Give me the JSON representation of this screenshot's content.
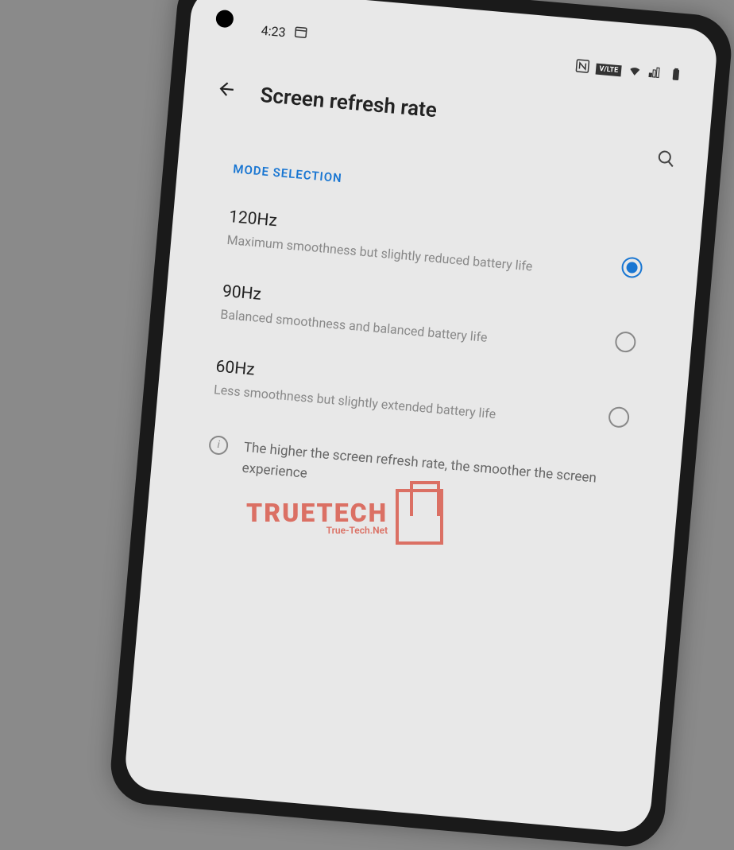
{
  "status_bar": {
    "time": "4:23",
    "volte_label": "V/LTE"
  },
  "header": {
    "title": "Screen refresh rate"
  },
  "section_label": "MODE SELECTION",
  "options": [
    {
      "title": "120Hz",
      "description": "Maximum smoothness but slightly reduced battery life",
      "selected": true
    },
    {
      "title": "90Hz",
      "description": "Balanced smoothness and balanced battery life",
      "selected": false
    },
    {
      "title": "60Hz",
      "description": "Less smoothness but slightly extended battery life",
      "selected": false
    }
  ],
  "info_text": "The higher the screen refresh rate, the smoother the screen experience",
  "watermark": {
    "main": "TRUETECH",
    "sub": "True-Tech.Net"
  }
}
